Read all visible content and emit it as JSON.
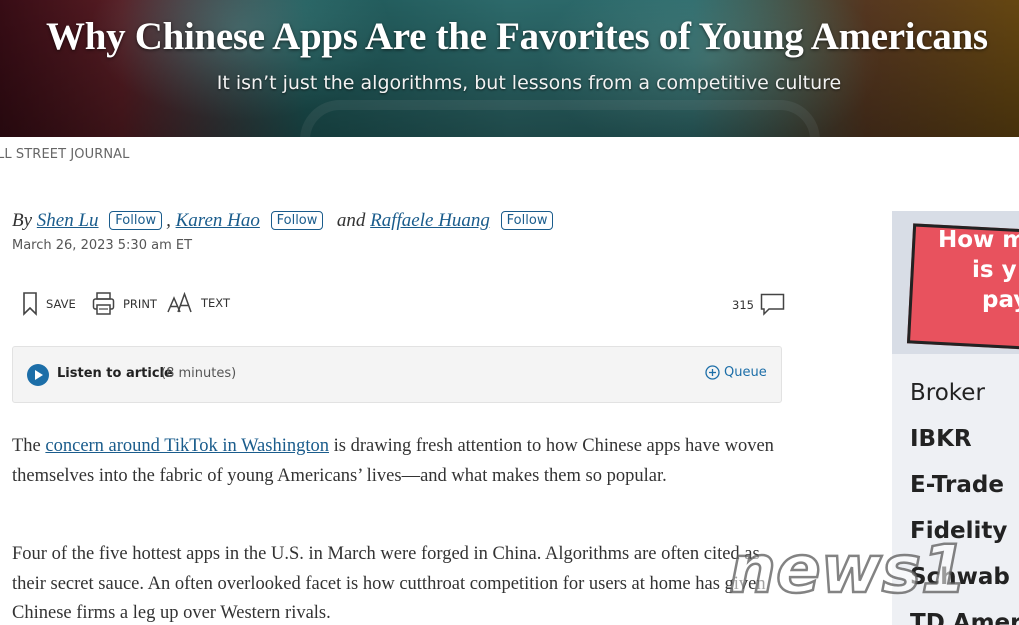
{
  "hero": {
    "title": "Why Chinese Apps Are the Favorites of Young Americans",
    "subtitle": "It isn’t just the algorithms, but lessons from a competitive culture"
  },
  "source": "LL STREET JOURNAL",
  "byline": {
    "by": "By",
    "authors": [
      "Shen Lu",
      "Karen Hao",
      "Raffaele Huang"
    ],
    "comma": ",",
    "and": "and",
    "follow_label": "Follow",
    "date": "March 26, 2023 5:30 am ET"
  },
  "tools": {
    "save": "SAVE",
    "print": "PRINT",
    "text": "TEXT",
    "comment_count": "315"
  },
  "listen": {
    "label": "Listen to article",
    "duration": "(8 minutes)",
    "queue": "Queue"
  },
  "article": {
    "p1_pre": "The ",
    "p1_link": "concern around TikTok in Washington",
    "p1_post": " is drawing fresh attention to how Chinese apps have woven themselves into the fabric of young Americans’ lives—and what makes them so popular.",
    "p2": "Four of the five hottest apps in the U.S. in March were forged in China. Algorithms are often cited as their secret sauce. An often overlooked facet is how cutthroat competition for users at home has given Chinese firms a leg up over Western rivals."
  },
  "ad": {
    "headline": [
      "How m",
      "is y",
      "pay"
    ],
    "items": [
      "Broker",
      "IBKR",
      "E-Trade",
      "Fidelity",
      "Schwab",
      "TD Amer"
    ]
  },
  "watermark": "news1",
  "colors": {
    "link": "#1a5c8c",
    "accent": "#1c6ea8",
    "ad_red": "#e8525e"
  }
}
